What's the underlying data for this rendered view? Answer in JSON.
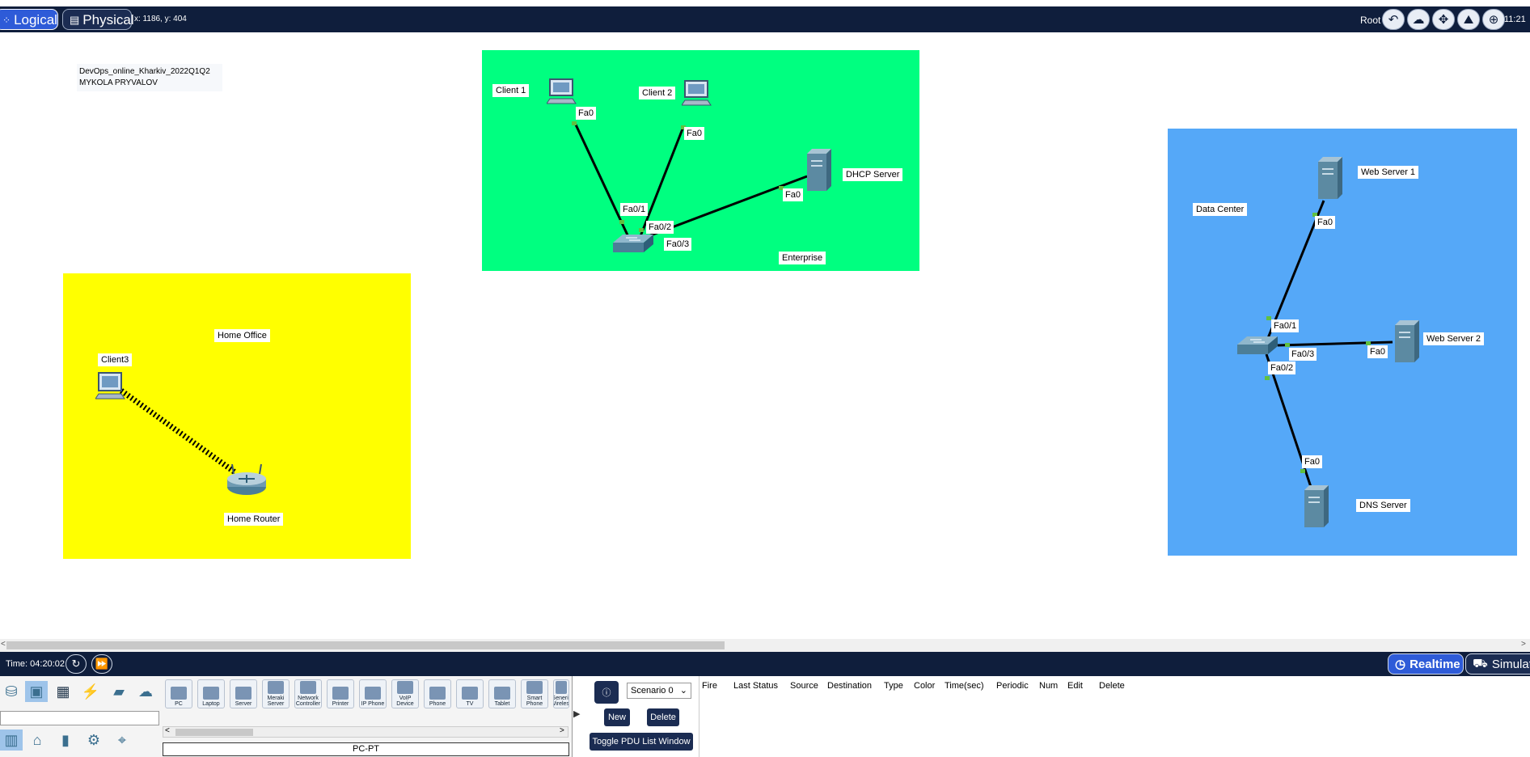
{
  "topbar": {
    "logical_label": "Logical",
    "physical_label": "Physical",
    "coords": "x: 1186, y: 404",
    "root_label": "Root",
    "clock": "11:21"
  },
  "workspace": {
    "note_line1": "DevOps_online_Kharkiv_2022Q1Q2",
    "note_line2": "MYKOLA PRYVALOV",
    "zones": {
      "enterprise": "Enterprise",
      "home": "Home Office",
      "datacenter": "Data Center"
    },
    "devices": {
      "client1": "Client 1",
      "client2": "Client 2",
      "dhcp": "DHCP Server",
      "client3": "Client3",
      "home_router": "Home Router",
      "web1": "Web Server 1",
      "web2": "Web Server 2",
      "dns": "DNS Server"
    },
    "ports": {
      "c1_fa0": "Fa0",
      "c2_fa0": "Fa0",
      "dhcp_fa0": "Fa0",
      "sw1_fa01": "Fa0/1",
      "sw1_fa02": "Fa0/2",
      "sw1_fa03": "Fa0/3",
      "web1_fa0": "Fa0",
      "web2_fa0": "Fa0",
      "dns_fa0": "Fa0",
      "sw2_fa01": "Fa0/1",
      "sw2_fa02": "Fa0/2",
      "sw2_fa03": "Fa0/3"
    },
    "colors": {
      "enterprise": "#00ff80",
      "home": "#ffff00",
      "datacenter": "#55a8f8"
    }
  },
  "timebar": {
    "time": "Time: 04:20:02",
    "realtime": "Realtime",
    "simulation": "Simulation"
  },
  "device_panel": {
    "tiles": [
      "PC",
      "Laptop",
      "Server",
      "Meraki Server",
      "Network Controller",
      "Printer",
      "IP Phone",
      "VoIP Device",
      "Phone",
      "TV",
      "Tablet",
      "Smart Phone",
      "Generic Wireless"
    ],
    "selected": "PC-PT"
  },
  "scenario": {
    "select": "Scenario 0",
    "new": "New",
    "delete": "Delete",
    "toggle": "Toggle PDU List Window"
  },
  "pdu_columns": [
    "Fire",
    "Last Status",
    "Source",
    "Destination",
    "Type",
    "Color",
    "Time(sec)",
    "Periodic",
    "Num",
    "Edit",
    "Delete"
  ]
}
